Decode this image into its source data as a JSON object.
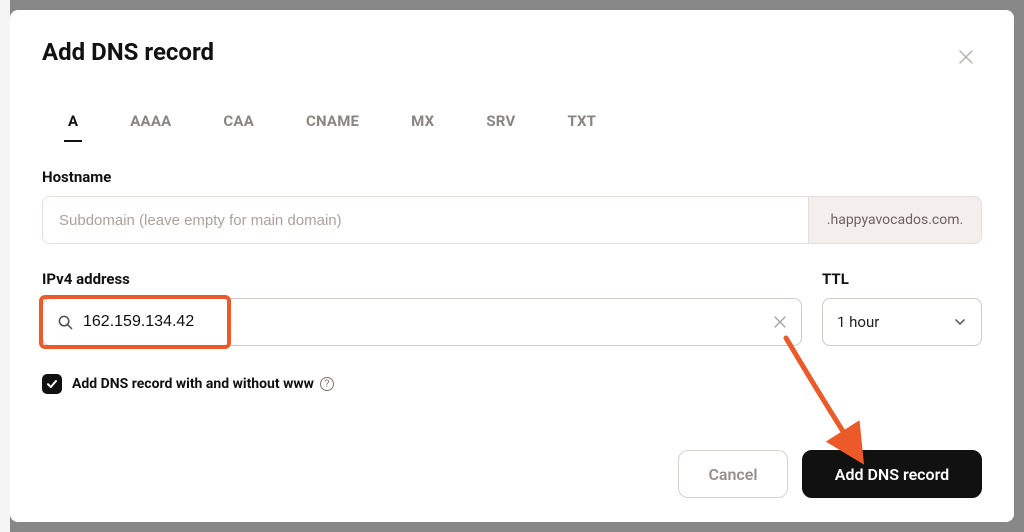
{
  "modal": {
    "title": "Add DNS record",
    "tabs": [
      "A",
      "AAAA",
      "CAA",
      "CNAME",
      "MX",
      "SRV",
      "TXT"
    ],
    "activeTabIndex": 0
  },
  "hostname": {
    "label": "Hostname",
    "placeholder": "Subdomain (leave empty for main domain)",
    "value": "",
    "domainSuffix": ".happyavocados.com."
  },
  "ipv4": {
    "label": "IPv4 address",
    "value": "162.159.134.42"
  },
  "ttl": {
    "label": "TTL",
    "value": "1 hour"
  },
  "checkbox": {
    "checked": true,
    "label": "Add DNS record with and without www"
  },
  "footer": {
    "cancel": "Cancel",
    "submit": "Add DNS record"
  },
  "colors": {
    "highlight": "#ec5a29",
    "primaryBg": "#111111"
  }
}
